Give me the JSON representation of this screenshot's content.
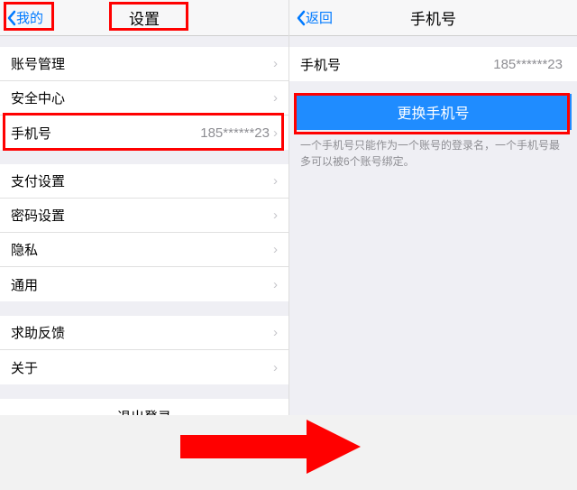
{
  "left": {
    "back_label": "我的",
    "title": "设置",
    "groups": [
      {
        "rows": [
          {
            "label": "账号管理",
            "value": ""
          },
          {
            "label": "安全中心",
            "value": ""
          },
          {
            "label": "手机号",
            "value": "185******23"
          }
        ]
      },
      {
        "rows": [
          {
            "label": "支付设置",
            "value": ""
          },
          {
            "label": "密码设置",
            "value": ""
          },
          {
            "label": "隐私",
            "value": ""
          },
          {
            "label": "通用",
            "value": ""
          }
        ]
      },
      {
        "rows": [
          {
            "label": "求助反馈",
            "value": ""
          },
          {
            "label": "关于",
            "value": ""
          }
        ]
      }
    ],
    "logout_label": "退出登录"
  },
  "right": {
    "back_label": "返回",
    "title": "手机号",
    "phone_row": {
      "label": "手机号",
      "value": "185******23"
    },
    "change_button": "更换手机号",
    "hint": "一个手机号只能作为一个账号的登录名，一个手机号最多可以被6个账号绑定。"
  }
}
